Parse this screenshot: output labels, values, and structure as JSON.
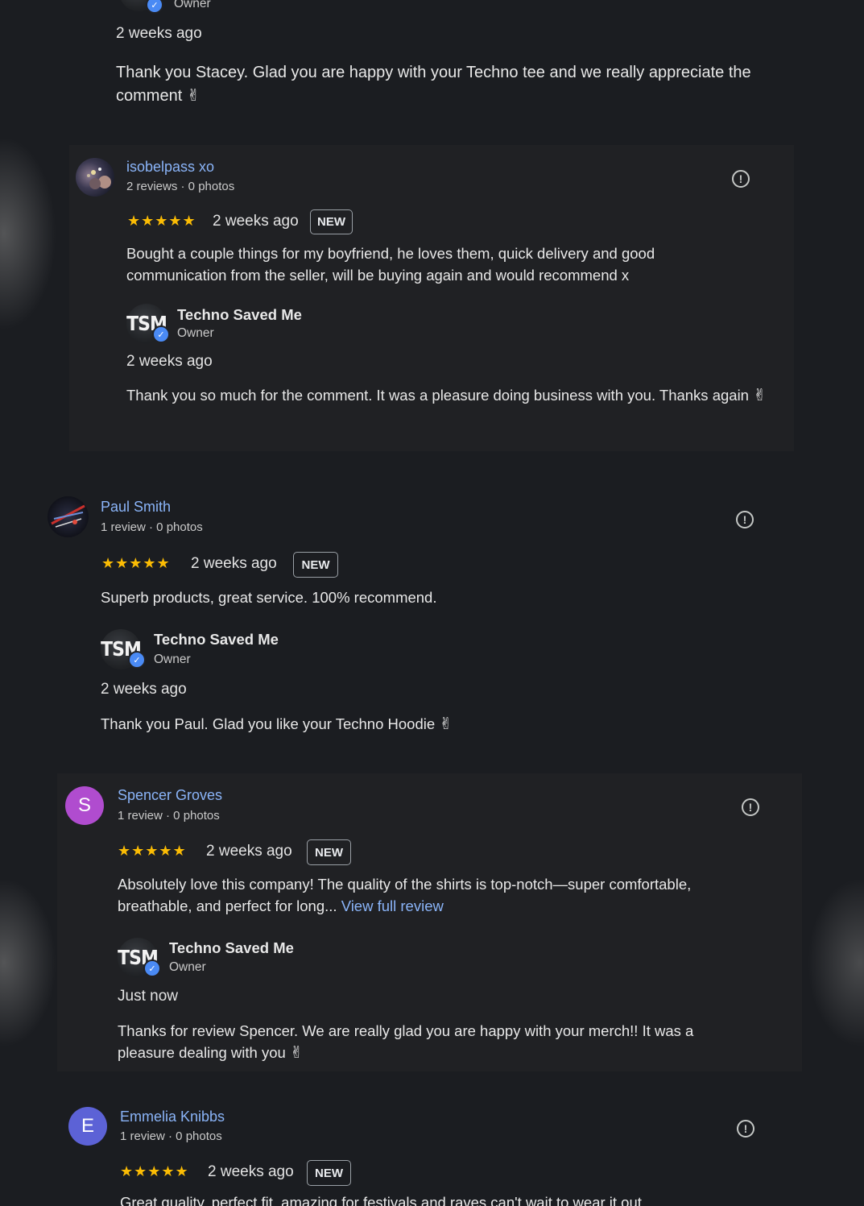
{
  "top_reply": {
    "owner_role": "Owner",
    "time": "2 weeks ago",
    "text": "Thank you Stacey. Glad you are happy with your Techno tee and we really appreciate the comment",
    "emoji": "✌"
  },
  "reviews": [
    {
      "name": "isobelpass xo",
      "meta": "2 reviews · 0 photos",
      "stars": "★★★★★",
      "time": "2 weeks ago",
      "badge": "NEW",
      "text": "Bought a couple things for my boyfriend, he loves them, quick delivery and good communication from the seller, will be buying again and would recommend x",
      "reply": {
        "owner_name": "Techno Saved Me",
        "owner_role": "Owner",
        "time": "2 weeks ago",
        "text": "Thank you so much for the comment. It was a pleasure doing business with you. Thanks again",
        "emoji": "✌"
      }
    },
    {
      "name": "Paul Smith",
      "meta": "1 review · 0 photos",
      "stars": "★★★★★",
      "time": "2 weeks ago",
      "badge": "NEW",
      "text": "Superb products, great service. 100% recommend.",
      "reply": {
        "owner_name": "Techno Saved Me",
        "owner_role": "Owner",
        "time": "2 weeks ago",
        "text": "Thank you Paul. Glad you like your Techno Hoodie",
        "emoji": "✌"
      }
    },
    {
      "name": "Spencer Groves",
      "avatar_letter": "S",
      "avatar_color": "#b04ccf",
      "meta": "1 review · 0 photos",
      "stars": "★★★★★",
      "time": "2 weeks ago",
      "badge": "NEW",
      "text": "Absolutely love this company! The quality of the shirts is top-notch—super comfortable, breathable, and perfect for long...",
      "more_link": "View full review",
      "reply": {
        "owner_name": "Techno Saved Me",
        "owner_role": "Owner",
        "time": "Just now",
        "text": "Thanks for review Spencer. We are really glad you are happy with your merch!! It was a pleasure dealing with you",
        "emoji": "✌"
      }
    },
    {
      "name": "Emmelia Knibbs",
      "avatar_letter": "E",
      "avatar_color": "#5c62d6",
      "meta": "1 review · 0 photos",
      "stars": "★★★★★",
      "time": "2 weeks ago",
      "badge": "NEW",
      "text": "Great quality, perfect fit, amazing for festivals and raves can't wait to wear it out"
    }
  ],
  "logo_text": "TSM",
  "icons": {
    "flag": "report-icon",
    "verified": "verified-check-icon"
  },
  "colors": {
    "background": "#1b1d21",
    "panel": "#202124",
    "link": "#8ab4f8",
    "star": "#fbbc04",
    "verified": "#4a8af4"
  }
}
